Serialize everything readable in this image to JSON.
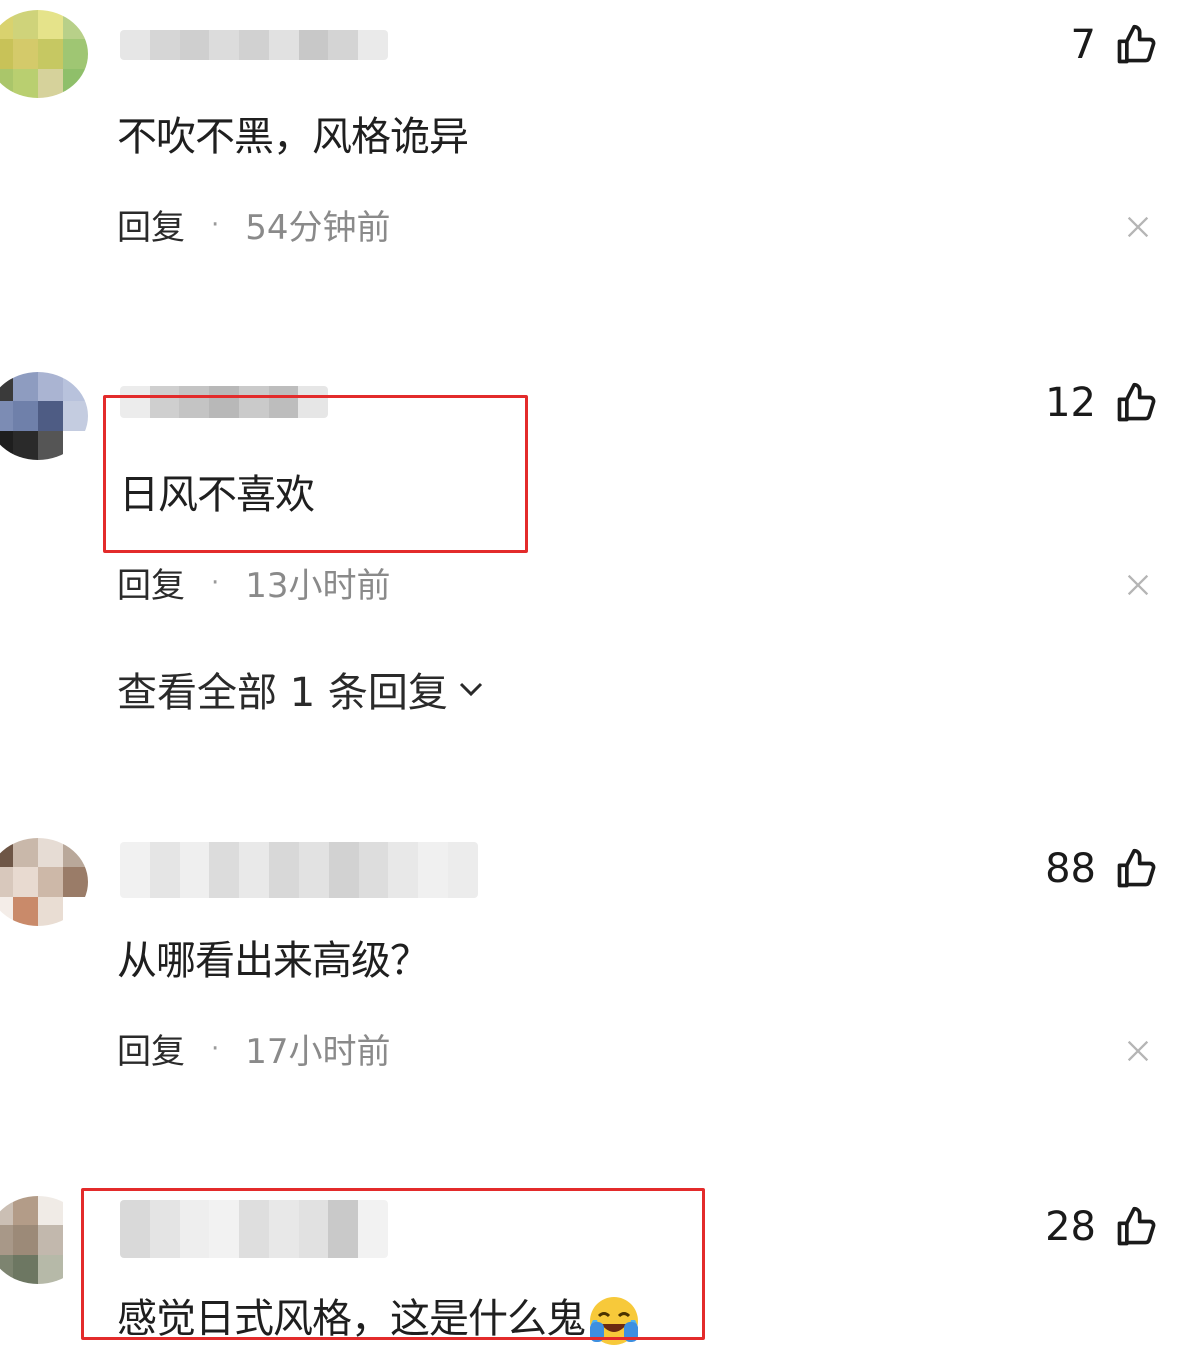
{
  "comments": [
    {
      "text": "不吹不黑，风格诡异",
      "likes": "7",
      "reply_label": "回复",
      "separator": "·",
      "time": "54分钟前"
    },
    {
      "text": "日风不喜欢",
      "likes": "12",
      "reply_label": "回复",
      "separator": "·",
      "time": "13小时前"
    },
    {
      "text": "从哪看出来高级？",
      "likes": "88",
      "reply_label": "回复",
      "separator": "·",
      "time": "17小时前"
    },
    {
      "text": "感觉日式风格，这是什么鬼",
      "likes": "28"
    }
  ],
  "view_all_replies": "查看全部 1 条回复",
  "colors": {
    "highlight_box": "#e32b2b",
    "time_text": "#8a8a8a"
  }
}
